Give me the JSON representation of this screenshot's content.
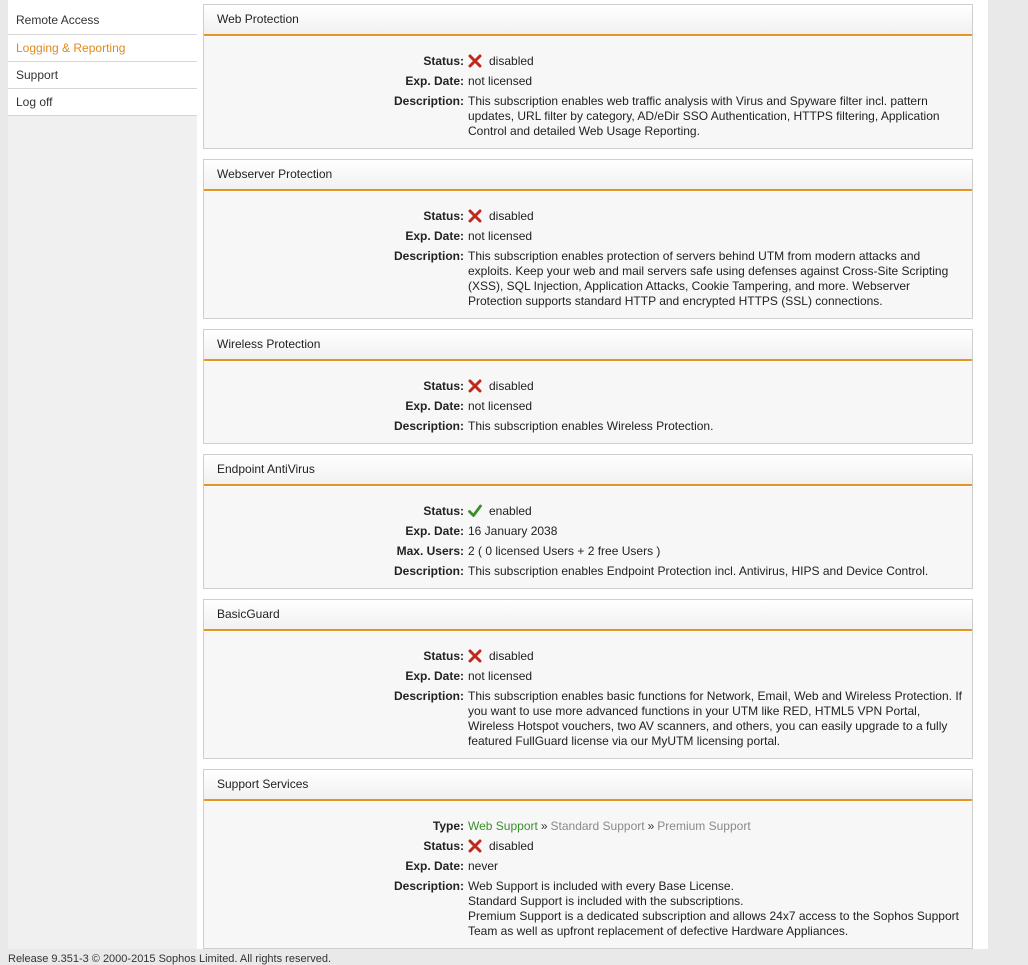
{
  "sidebar": {
    "items": [
      {
        "label": "Remote Access",
        "active": false
      },
      {
        "label": "Logging & Reporting",
        "active": true
      },
      {
        "label": "Support",
        "active": false
      },
      {
        "label": "Log off",
        "active": false
      }
    ]
  },
  "labels": {
    "status": "Status:",
    "exp_date": "Exp. Date:",
    "description": "Description:",
    "max_users": "Max. Users:",
    "type": "Type:"
  },
  "panels": [
    {
      "title": "Web Protection",
      "status": "disabled",
      "exp_date": "not licensed",
      "description": "This subscription enables web traffic analysis with Virus and Spyware filter incl. pattern updates, URL filter by category, AD/eDir SSO Authentication, HTTPS filtering, Application Control and detailed Web Usage Reporting."
    },
    {
      "title": "Webserver Protection",
      "status": "disabled",
      "exp_date": "not licensed",
      "description": "This subscription enables protection of servers behind UTM from modern attacks and exploits. Keep your web and mail servers safe using defenses against Cross-Site Scripting (XSS), SQL Injection, Application Attacks, Cookie Tampering, and more. Webserver Protection supports standard HTTP and encrypted HTTPS (SSL) connections."
    },
    {
      "title": "Wireless Protection",
      "status": "disabled",
      "exp_date": "not licensed",
      "description": "This subscription enables Wireless Protection."
    },
    {
      "title": "Endpoint AntiVirus",
      "status": "enabled",
      "exp_date": "16 January 2038",
      "max_users": "2 ( 0 licensed Users + 2 free Users )",
      "description": "This subscription enables Endpoint Protection incl. Antivirus, HIPS and Device Control."
    },
    {
      "title": "BasicGuard",
      "status": "disabled",
      "exp_date": "not licensed",
      "description": "This subscription enables basic functions for Network, Email, Web and Wireless Protection. If you want to use more advanced functions in your UTM like RED, HTML5 VPN Portal, Wireless Hotspot vouchers, two AV scanners, and others, you can easily upgrade to a fully featured FullGuard license via our MyUTM licensing portal."
    }
  ],
  "support": {
    "title": "Support Services",
    "types": [
      "Web Support",
      "Standard Support",
      "Premium Support"
    ],
    "type_sep": "»",
    "status": "disabled",
    "exp_date": "never",
    "description_lines": [
      "Web Support is included with every Base License.",
      "Standard Support is included with the subscriptions.",
      "Premium Support is a dedicated subscription and allows 24x7 access to the Sophos Support Team as well as upfront replacement of defective Hardware Appliances."
    ]
  },
  "footer": "Release 9.351-3 © 2000-2015 Sophos Limited. All rights reserved.",
  "colors": {
    "accent": "#e69524",
    "active_nav": "#e08a1e",
    "enabled": "#3a8f2a",
    "disabled": "#c0281e"
  },
  "icons": {
    "disabled": "red-x-icon",
    "enabled": "green-check-icon"
  }
}
